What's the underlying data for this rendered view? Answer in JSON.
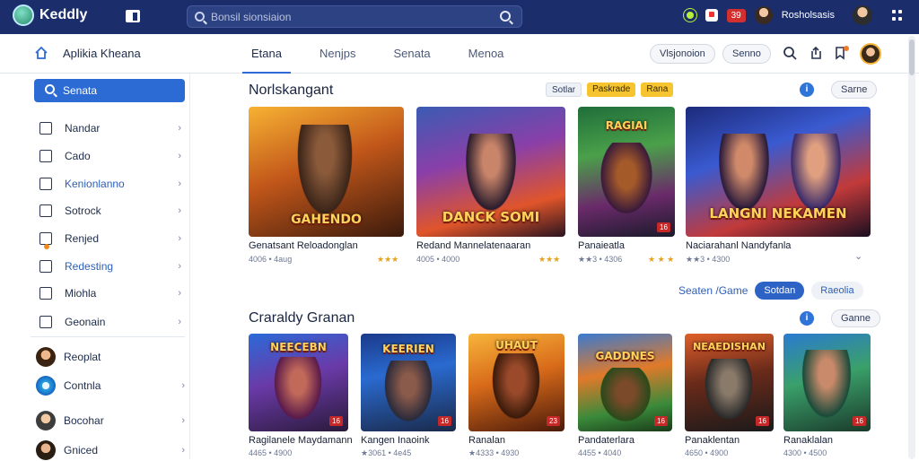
{
  "topbar": {
    "logo_text": "Keddly",
    "search_placeholder": "Bonsil sionsiaion",
    "badge_count": "39",
    "user_name": "Rosholsasis"
  },
  "subbar": {
    "app_title": "Aplikia Kheana",
    "tabs": [
      {
        "label": "Etana",
        "active": true
      },
      {
        "label": "Nenjps",
        "active": false
      },
      {
        "label": "Senata",
        "active": false
      },
      {
        "label": "Menoa",
        "active": false
      }
    ],
    "pill_primary": "Vlsjonoion",
    "pill_secondary": "Senno"
  },
  "sidebar": {
    "search_label": "Senata",
    "items": [
      {
        "label": "Nandar",
        "icon": "bookmark-icon"
      },
      {
        "label": "Cado",
        "icon": "tag-icon"
      },
      {
        "label": "Kenionlanno",
        "icon": "flag-icon",
        "highlight": true
      },
      {
        "label": "Sotrock",
        "icon": "list-icon"
      },
      {
        "label": "Renjed",
        "icon": "square-icon"
      },
      {
        "label": "Redesting",
        "icon": "gift-icon",
        "highlight": true
      },
      {
        "label": "Miohla",
        "icon": "chart-icon"
      },
      {
        "label": "Geonain",
        "icon": "message-icon"
      }
    ],
    "users": [
      {
        "label": "Reoplat"
      },
      {
        "label": "Contnla"
      },
      {
        "label": "Bocohar"
      },
      {
        "label": "Gniced"
      }
    ]
  },
  "section1": {
    "title": "Norlskangant",
    "chip1": "Sotlar",
    "chip2": "Paskrade",
    "chip3": "Rana",
    "pill": "Sarne",
    "cards": [
      {
        "title": "Genatsant Reloadonglan",
        "meta": "4006 • 4aug",
        "stars": "★★★",
        "thumb_text": "GAHENDO"
      },
      {
        "title": "Redand Mannelatenaaran",
        "meta": "4005 • 4000",
        "stars": "★★★",
        "thumb_text": "DANCK SOMI"
      },
      {
        "title": "Panaieatla",
        "meta": "★★3 • 4306",
        "stars": "★ ★ ★",
        "age": "16",
        "thumb_text": "RAGIAI"
      },
      {
        "title": "Naciarahanl Nandyfanla",
        "meta": "★★3 • 4300",
        "stars": "",
        "thumb_text": "LANGNI NEKAMEN"
      }
    ]
  },
  "filters": {
    "link": "Seaten /Game",
    "active": "Sotdan",
    "plain": "Raeolia"
  },
  "section2": {
    "title": "Craraldy Granan",
    "pill": "Ganne",
    "cards": [
      {
        "title": "Ragilanele Maydamann",
        "meta": "4465 • 4900",
        "age": "16",
        "thumb_text": "NEECEBN"
      },
      {
        "title": "Kangen Inaoink",
        "meta": "★3061 • 4e45",
        "age": "16",
        "thumb_text": "KEERIEN"
      },
      {
        "title": "Ranalan",
        "meta": "★4333 • 4930",
        "age": "23",
        "thumb_text": "UHAUT"
      },
      {
        "title": "Pandaterlara",
        "meta": "4455 • 4040",
        "age": "16",
        "thumb_text": "GADDNES"
      },
      {
        "title": "Panaklentan",
        "meta": "4650 • 4900",
        "age": "16",
        "thumb_text": "NEAEDISHAN"
      },
      {
        "title": "Ranaklalan",
        "meta": "4300 • 4500",
        "age": "16",
        "thumb_text": ""
      }
    ]
  },
  "colors": {
    "topbar": "#1b2e6b",
    "accent": "#2c6bd3",
    "age_badge": "#c62828",
    "star": "#e7a21d"
  }
}
